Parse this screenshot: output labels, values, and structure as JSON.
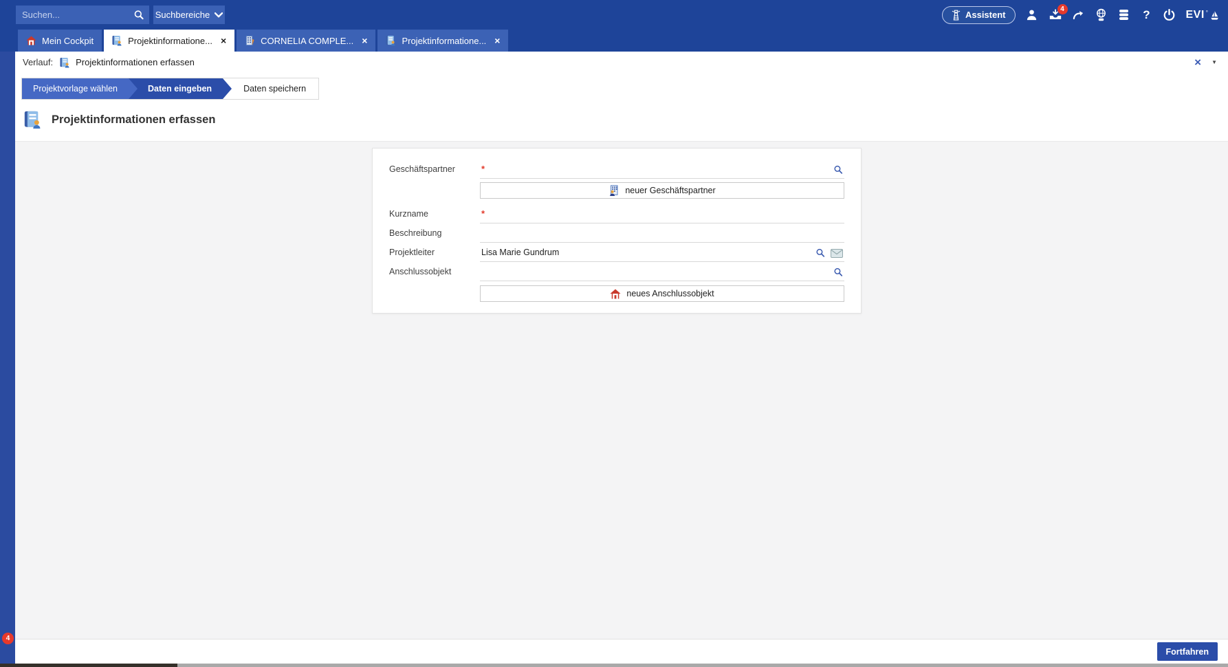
{
  "theme": {
    "topbar": "#1e4499",
    "tab_inactive": "#3c62b5",
    "accent": "#2b4da9",
    "step_done": "#4568c4",
    "alert_red": "#e8392b",
    "content_bg": "#f4f4f5"
  },
  "icons": {
    "close": "×",
    "caret_down": "▼",
    "expand": ">"
  },
  "topbar": {
    "search_placeholder": "Suchen...",
    "scope_label": "Suchbereiche",
    "assistant_label": "Assistent",
    "notification_count": "4",
    "help_label": "?",
    "brand": "EVI",
    "brand_mark": "°"
  },
  "tabs": [
    {
      "label": "Mein Cockpit",
      "icon": "home",
      "active": false
    },
    {
      "label": "Projektinformatione...",
      "icon": "project-document",
      "active": true
    },
    {
      "label": "CORNELIA COMPLE...",
      "icon": "building",
      "active": false
    },
    {
      "label": "Projektinformatione...",
      "icon": "project-document",
      "active": false
    }
  ],
  "history": {
    "label": "Verlauf:",
    "entry": "Projektinformationen erfassen"
  },
  "wizard": {
    "steps": [
      {
        "label": "Projektvorlage wählen",
        "state": "done"
      },
      {
        "label": "Daten eingeben",
        "state": "active"
      },
      {
        "label": "Daten speichern",
        "state": "pending"
      }
    ]
  },
  "page": {
    "title": "Projektinformationen erfassen"
  },
  "form": {
    "required_marker": "*",
    "fields": [
      {
        "label": "Geschäftspartner",
        "required": true,
        "value": "",
        "icons": [
          "search"
        ]
      },
      {
        "label": "Kurzname",
        "required": true,
        "value": "",
        "icons": []
      },
      {
        "label": "Beschreibung",
        "required": false,
        "value": "",
        "icons": []
      },
      {
        "label": "Projektleiter",
        "required": false,
        "value": "Lisa Marie Gundrum",
        "icons": [
          "search",
          "mail"
        ]
      },
      {
        "label": "Anschlussobjekt",
        "required": false,
        "value": "",
        "icons": [
          "search"
        ]
      }
    ],
    "new_partner_label": "neuer Geschäftspartner",
    "new_object_label": "neues Anschlussobjekt"
  },
  "footer": {
    "continue_label": "Fortfahren",
    "badge_count": "4"
  }
}
